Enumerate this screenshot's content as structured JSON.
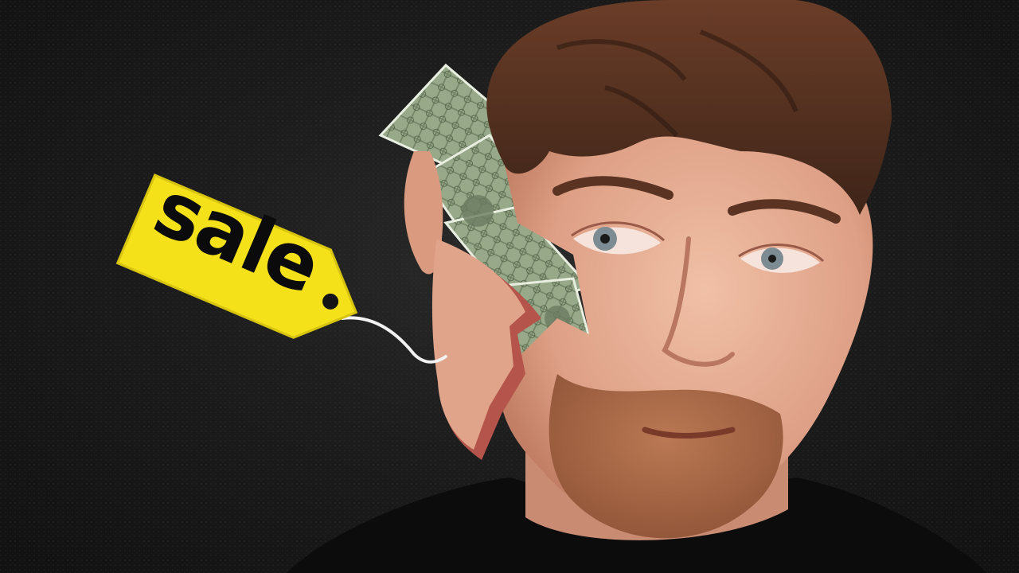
{
  "price_tag": {
    "label": "sale",
    "color": "#f4e11a",
    "text_color": "#0b0b0b"
  },
  "palette": {
    "background": "#161616",
    "hair": "#5a3322",
    "skin": "#e3a98f",
    "beard": "#a7643f",
    "shirt": "#0c0c0c",
    "money": "#8fa07e",
    "flesh_edge": "#b5544a"
  }
}
